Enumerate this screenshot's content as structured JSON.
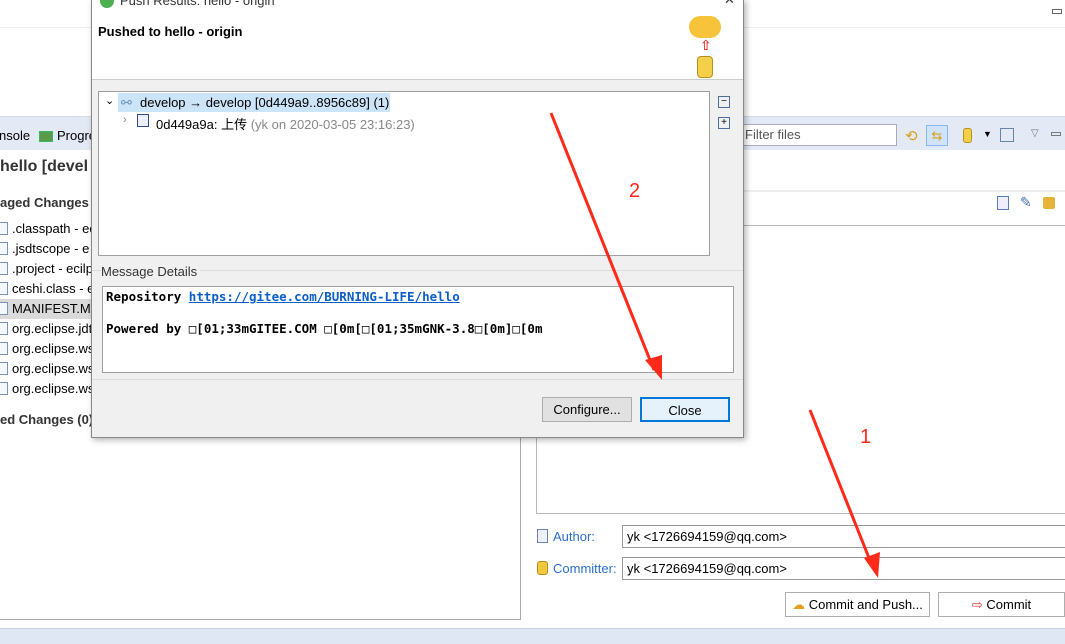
{
  "dialog": {
    "title": "Push Results: hello - origin",
    "heading": "Pushed to hello - origin",
    "tree": {
      "branch": "develop → develop [0d449a9..8956c89] (1)",
      "commit_id": "0d449a9a: 上传",
      "commit_meta": "(yk on 2020-03-05 23:16:23)"
    },
    "message_details_label": "Message Details",
    "message": {
      "repo_label": "Repository",
      "repo_url": "https://gitee.com/BURNING-LIFE/hello",
      "powered": "Powered by □[01;33mGITEE.COM □[0m[□[01;35mGNK-3.8□[0m]□[0m"
    },
    "configure_label": "Configure...",
    "close_label": "Close"
  },
  "left": {
    "tabs": [
      "nsole",
      "Progre"
    ],
    "title": "hello [devel",
    "unstaged_label": "aged Changes (",
    "files": [
      ".classpath - ec",
      ".jsdtscope - e",
      ".project - ecilp",
      "ceshi.class - e",
      "MANIFEST.MF",
      "org.eclipse.jdt",
      "org.eclipse.ws",
      "org.eclipse.ws",
      "org.eclipse.ws"
    ],
    "selected_index": 4,
    "staged_label": "ed Changes (0)"
  },
  "right": {
    "filter_placeholder": "Filter files",
    "author_label": "Author:",
    "author_value": "yk <1726694159@qq.com>",
    "committer_label": "Committer:",
    "committer_value": "yk <1726694159@qq.com>",
    "commit_push_label": "Commit and Push...",
    "commit_label": "Commit"
  },
  "annotations": {
    "one": "1",
    "two": "2",
    "color": "#ff2a1a"
  }
}
